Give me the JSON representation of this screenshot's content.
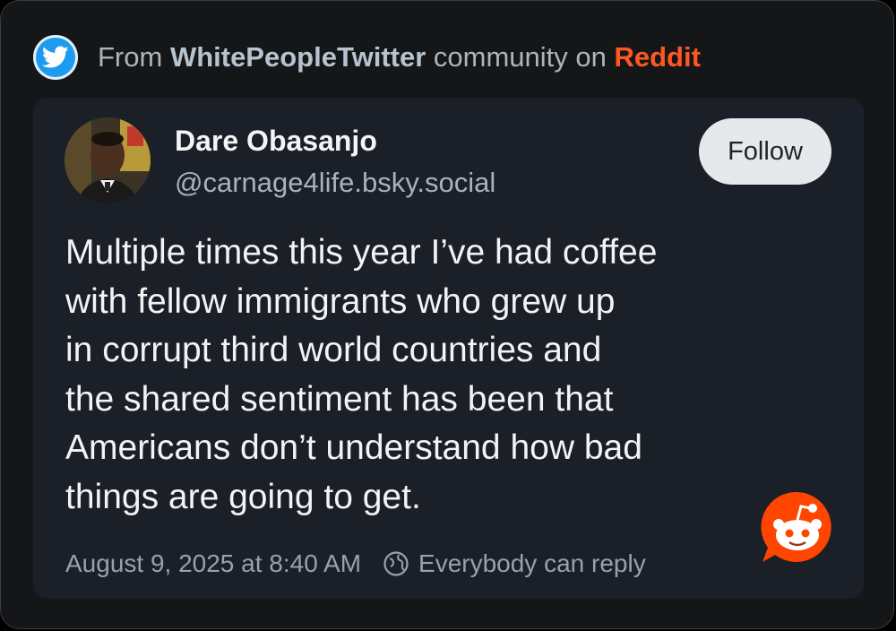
{
  "header": {
    "prefix": "From ",
    "community": "WhitePeopleTwitter",
    "middle": " community on ",
    "brand": "Reddit",
    "icon": "twitter-bird-icon"
  },
  "post": {
    "author_name": "Dare Obasanjo",
    "author_handle": "@carnage4life.bsky.social",
    "follow_label": "Follow",
    "text_lines": [
      "Multiple times this year I’ve had coffee",
      "with fellow immigrants who grew up",
      "in corrupt third world countries and",
      "the shared sentiment has been that",
      "Americans don’t understand how bad",
      "things are going to get."
    ],
    "timestamp": "August 9, 2025 at 8:40 AM",
    "reply_setting": "Everybody can reply"
  },
  "colors": {
    "accent_reddit": "#ff5722",
    "twitter_blue": "#1d9bf0",
    "card_bg": "#1b1f28"
  }
}
